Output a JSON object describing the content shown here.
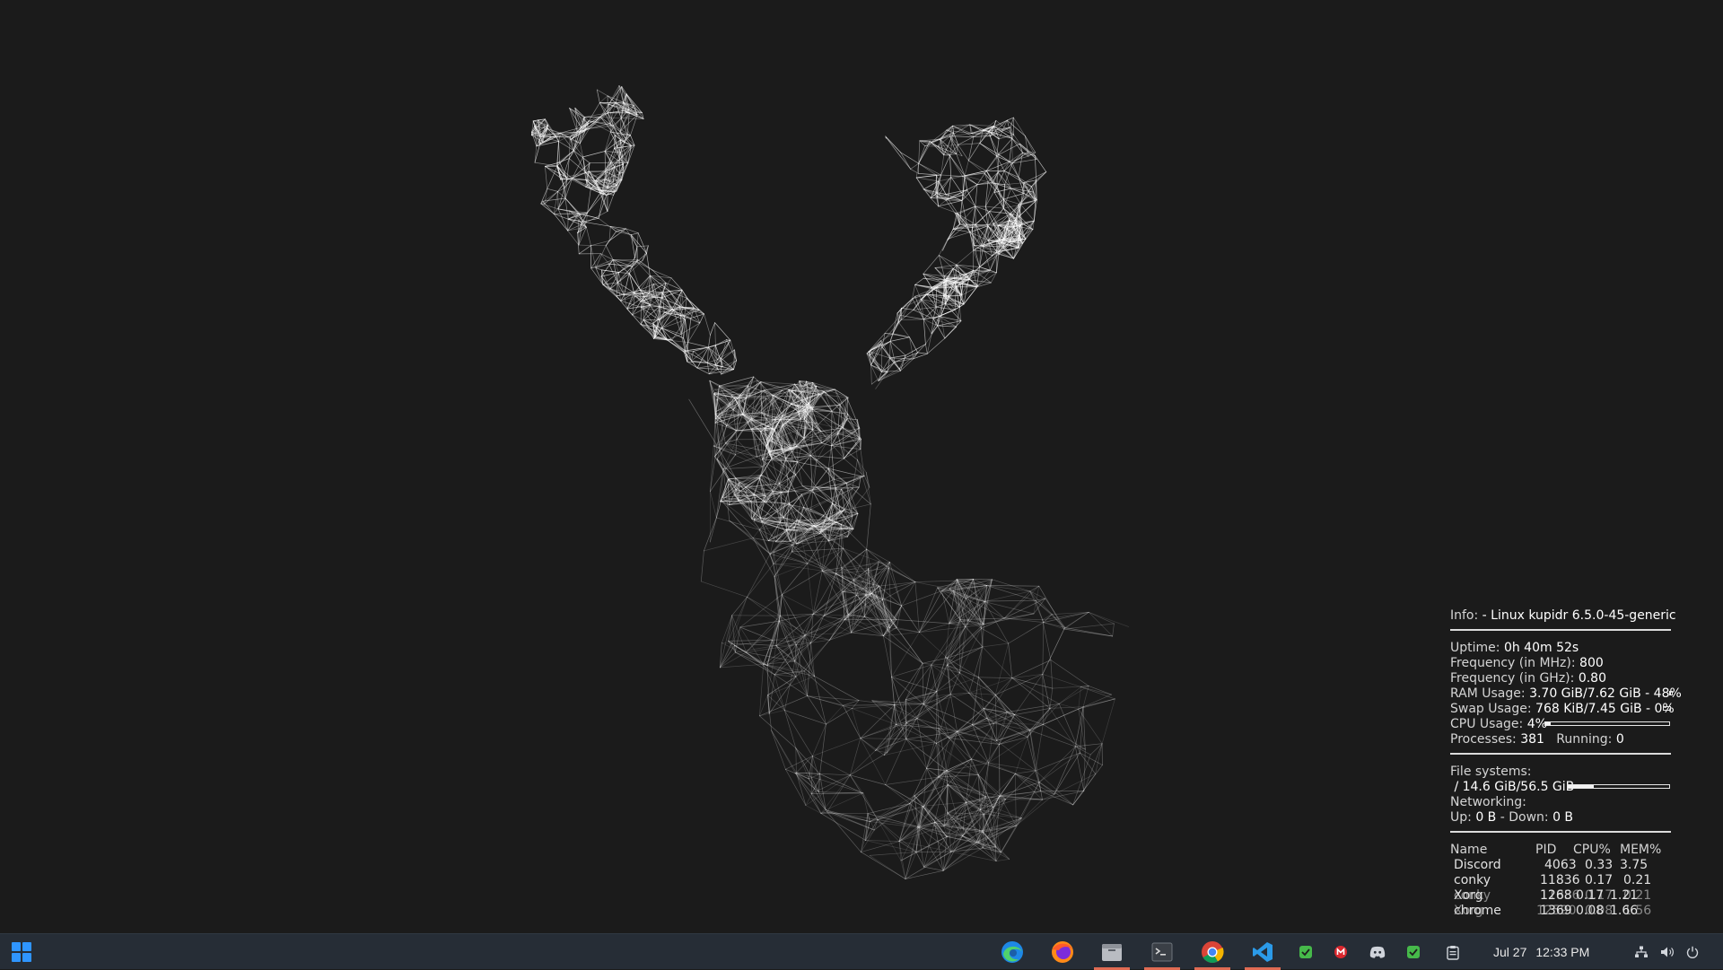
{
  "desktop": {
    "background_color": "#1b1b1b"
  },
  "conky": {
    "info": {
      "label": "Info:",
      "value": "- Linux kupidr 6.5.0-45-generic"
    },
    "uptime": {
      "label": "Uptime:",
      "value": "0h 40m 52s"
    },
    "freq_mhz": {
      "label": "Frequency (in MHz):",
      "value": "800"
    },
    "freq_ghz": {
      "label": "Frequency (in GHz):",
      "value": "0.80"
    },
    "ram": {
      "label": "RAM Usage:",
      "value": "3.70 GiB/7.62 GiB - 48%",
      "percent": 48
    },
    "swap": {
      "label": "Swap Usage:",
      "value": "768 KiB/7.45 GiB - 0%",
      "percent": 0
    },
    "cpu": {
      "label": "CPU Usage:",
      "value": "4%",
      "percent": 4
    },
    "processes": {
      "label": "Processes:",
      "value": "381",
      "running_label": "Running:",
      "running_value": "0"
    },
    "filesystems": {
      "label": "File systems:",
      "root": "/ 14.6 GiB/56.5 GiB",
      "percent": 26
    },
    "networking": {
      "label": "Networking:",
      "up_label": "Up:",
      "up_value": "0 B",
      "down_label": "- Down:",
      "down_value": "0 B"
    },
    "table": {
      "headers": [
        "Name",
        "PID",
        "CPU%",
        "MEM%"
      ],
      "rows": [
        {
          "name": "Discord",
          "pid": "4063",
          "cpu": "0.33",
          "mem": "3.75"
        },
        {
          "name": "conky",
          "pid": "11836",
          "cpu": "0.17",
          "mem": "0.21"
        },
        {
          "name": "Xorg",
          "pid": "1268",
          "cpu": "0.17",
          "mem": "1.21",
          "ghost_name": "conky",
          "ghost_pid": "11836",
          "ghost_cpu": "0.17",
          "ghost_mem": "0.21"
        },
        {
          "name": "chrome",
          "pid": "1369",
          "cpu": "0.08",
          "mem": "1.66",
          "ghost_name": "Xorg",
          "ghost_pid": "12590",
          "ghost_cpu": "0.08",
          "ghost_mem": "1.56"
        }
      ]
    }
  },
  "taskbar": {
    "apps": [
      {
        "icon": "edge-icon",
        "active": false
      },
      {
        "icon": "firefox-icon",
        "active": false
      },
      {
        "icon": "files-icon",
        "active": true
      },
      {
        "icon": "terminal-icon",
        "active": true
      },
      {
        "icon": "chrome-icon",
        "active": true
      },
      {
        "icon": "vscode-icon",
        "active": true
      }
    ],
    "tray": [
      "shield-check-icon",
      "mega-icon",
      "discord-icon",
      "shield-check-icon",
      "clipboard-icon"
    ],
    "clock": {
      "date": "Jul 27",
      "time": "12:33 PM"
    },
    "status": [
      "network-icon",
      "volume-icon",
      "power-icon"
    ],
    "accent": "#e06b53"
  }
}
